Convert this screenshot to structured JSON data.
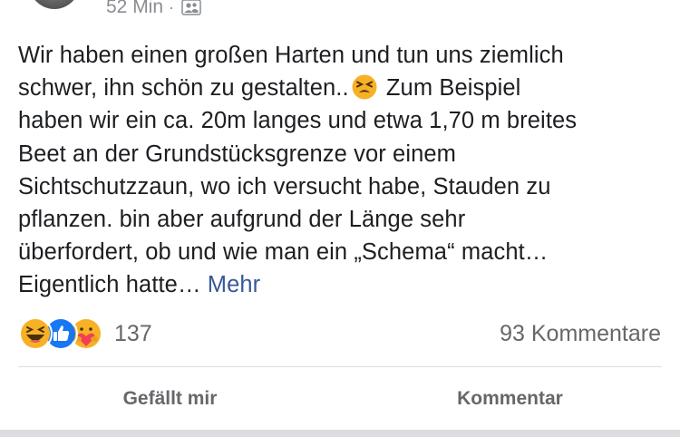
{
  "post": {
    "timestamp": "52 Min",
    "separator": "·",
    "audience_icon": "friends-icon",
    "text_lines": [
      "Wir haben einen großen Harten und tun uns ziemlich",
      "schwer, ihn schön zu gestalten..",
      "Zum Beispiel",
      "haben wir ein ca. 20m langes und etwa 1,70 m breites",
      "Beet an der Grundstücksgrenze vor einem",
      "Sichtschutzzaun, wo ich versucht habe, Stauden zu",
      "pflanzen. bin aber aufgrund der Länge sehr",
      "überfordert, ob und wie man ein „Schema“ macht…",
      "Eigentlich hatte…"
    ],
    "inline_emoji": "tired-face-emoji",
    "more_label": "Mehr"
  },
  "reactions": {
    "icons": [
      "haha-reaction-icon",
      "like-reaction-icon",
      "care-reaction-icon"
    ],
    "count": "137"
  },
  "comments": {
    "count_label": "93 Kommentare"
  },
  "actions": {
    "like_label": "Gefällt mir",
    "comment_label": "Kommentar"
  },
  "colors": {
    "text": "#1c1e21",
    "secondary": "#65676b",
    "link": "#385898",
    "like_blue": "#1877f2",
    "haha_yellow": "#f7b125"
  }
}
